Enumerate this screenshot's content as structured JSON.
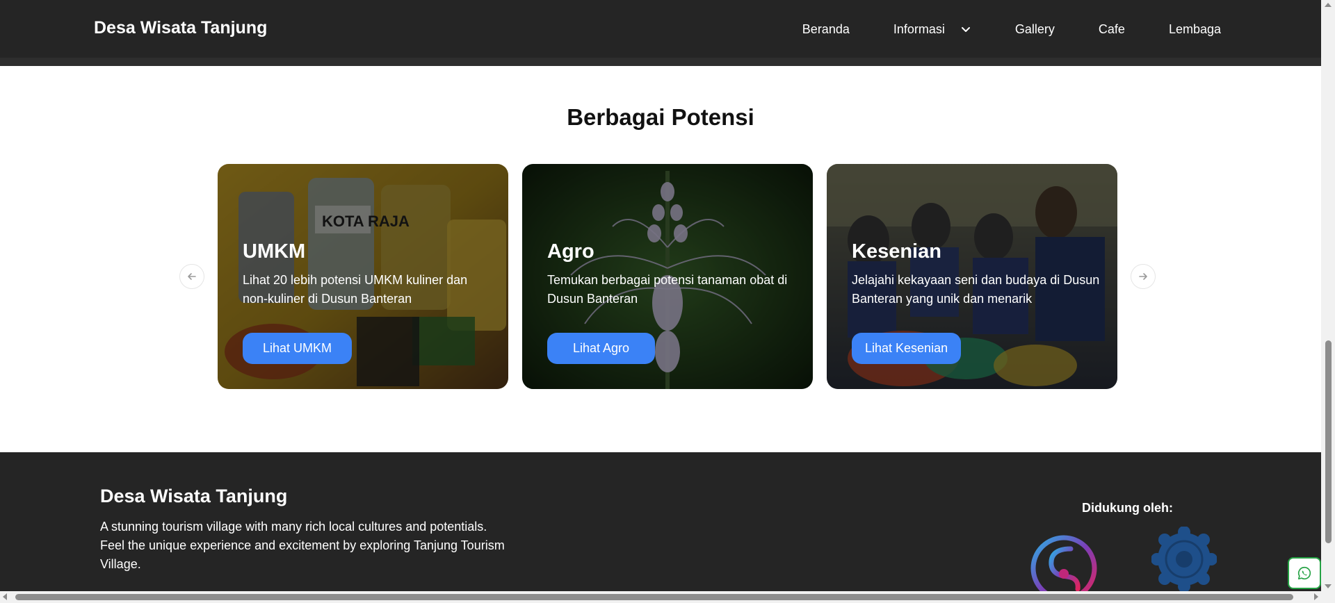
{
  "header": {
    "brand": "Desa Wisata Tanjung",
    "nav": [
      {
        "label": "Beranda"
      },
      {
        "label": "Informasi",
        "icon": "chevron-down-icon"
      },
      {
        "label": "Gallery"
      },
      {
        "label": "Cafe"
      },
      {
        "label": "Lembaga"
      }
    ]
  },
  "potensi": {
    "title": "Berbagai Potensi",
    "cards": [
      {
        "title": "UMKM",
        "desc": "Lihat 20 lebih potensi UMKM kuliner dan non-kuliner di Dusun Banteran",
        "button": "Lihat UMKM",
        "brand_text": "KOTA RAJA"
      },
      {
        "title": "Agro",
        "desc": "Temukan berbagai potensi tanaman obat di Dusun Banteran",
        "button": "Lihat Agro"
      },
      {
        "title": "Kesenian",
        "desc": "Jelajahi kekayaan seni dan budaya di Dusun Banteran yang unik dan menarik",
        "button": "Lihat Kesenian"
      }
    ],
    "prev_icon": "arrow-left-icon",
    "next_icon": "arrow-right-icon"
  },
  "footer": {
    "title": "Desa Wisata Tanjung",
    "desc": "A stunning tourism village with many rich local cultures and potentials. Feel the unique experience and excitement by exploring Tanjung Tourism Village.",
    "support_label": "Didukung oleh:"
  },
  "colors": {
    "nav_bg": "#252525",
    "button_blue": "#3b82f6",
    "whatsapp": "#25a244"
  }
}
